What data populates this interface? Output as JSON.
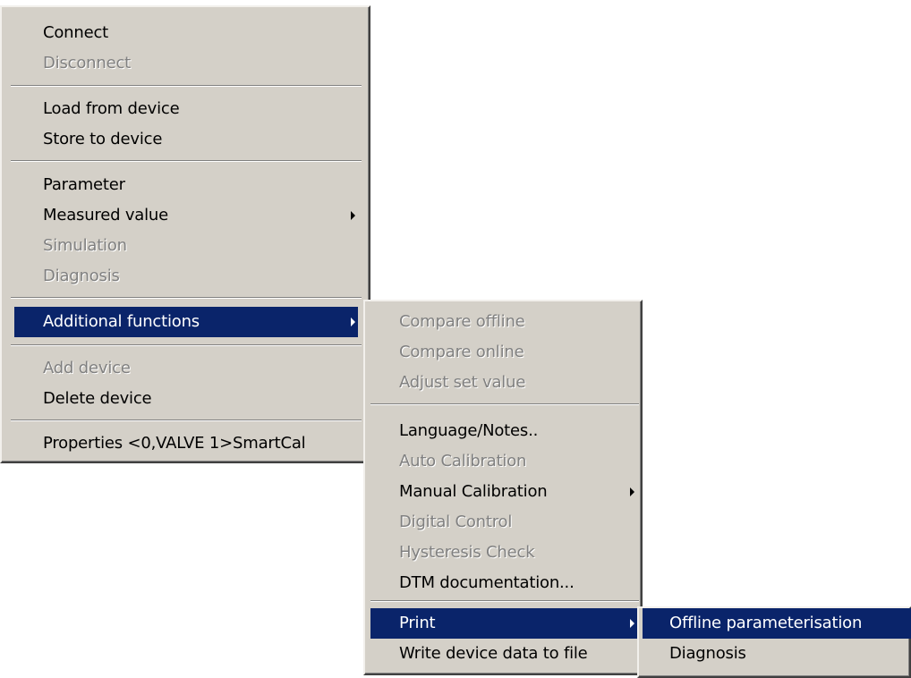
{
  "main_menu": {
    "connect": "Connect",
    "disconnect": "Disconnect",
    "load_from_device": "Load from device",
    "store_to_device": "Store to device",
    "parameter": "Parameter",
    "measured_value": "Measured value",
    "simulation": "Simulation",
    "diagnosis": "Diagnosis",
    "additional_functions": "Additional functions",
    "add_device": "Add device",
    "delete_device": "Delete device",
    "properties": "Properties <0,VALVE 1>SmartCal"
  },
  "additional_functions_menu": {
    "compare_offline": "Compare offline",
    "compare_online": "Compare online",
    "adjust_set_value": "Adjust set value",
    "language_notes": "Language/Notes..",
    "auto_calibration": "Auto Calibration",
    "manual_calibration": "Manual Calibration",
    "digital_control": "Digital Control",
    "hysteresis_check": "Hysteresis Check",
    "dtm_documentation": "DTM documentation...",
    "print": "Print",
    "write_device_data": "Write device data to file"
  },
  "print_menu": {
    "offline_parameterisation": "Offline parameterisation",
    "diagnosis": "Diagnosis"
  },
  "colors": {
    "menu_bg": "#d4d0c8",
    "highlight_bg": "#0a246a",
    "disabled_text": "#808080"
  }
}
